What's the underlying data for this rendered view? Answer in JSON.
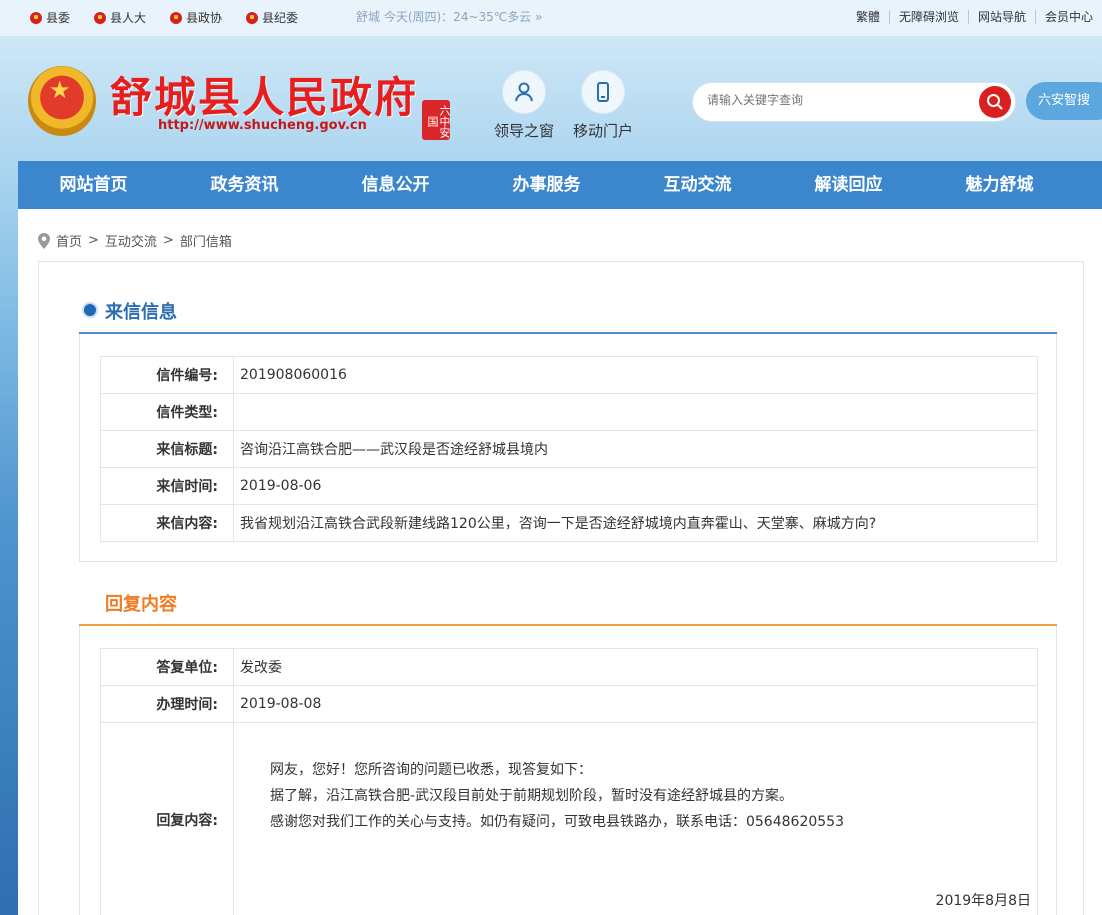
{
  "topbar": {
    "links": [
      "县委",
      "县人大",
      "县政协",
      "县纪委"
    ],
    "weather": "舒城   今天(周四)：24~35℃多云 »",
    "right": [
      "繁體",
      "无障碍浏览",
      "网站导航",
      "会员中心"
    ]
  },
  "header": {
    "title": "舒城县人民政府",
    "url": "http://www.shucheng.gov.cn",
    "seal_text": "六中安国",
    "quick": [
      {
        "label": "领导之窗",
        "icon": "person-icon"
      },
      {
        "label": "移动门户",
        "icon": "mobile-icon"
      }
    ],
    "search_placeholder": "请输入关键字查询",
    "la_search": "六安智搜"
  },
  "nav": [
    "网站首页",
    "政务资讯",
    "信息公开",
    "办事服务",
    "互动交流",
    "解读回应",
    "魅力舒城"
  ],
  "breadcrumb": {
    "home": "首页",
    "sep": ">",
    "level1": "互动交流",
    "level2": "部门信箱"
  },
  "letter": {
    "section_title": "来信信息",
    "rows": [
      {
        "label": "信件编号:",
        "value": "201908060016"
      },
      {
        "label": "信件类型:",
        "value": ""
      },
      {
        "label": "来信标题:",
        "value": "咨询沿江高铁合肥——武汉段是否途经舒城县境内"
      },
      {
        "label": "来信时间:",
        "value": "2019-08-06"
      },
      {
        "label": "来信内容:",
        "value": "我省规划沿江高铁合武段新建线路120公里，咨询一下是否途经舒城境内直奔霍山、天堂寨、麻城方向?"
      }
    ]
  },
  "reply": {
    "section_title": "回复内容",
    "unit_label": "答复单位:",
    "unit_value": "发改委",
    "time_label": "办理时间:",
    "time_value": "2019-08-08",
    "content_label": "回复内容:",
    "lines": [
      "网友，您好！您所咨询的问题已收悉，现答复如下：",
      "据了解，沿江高铁合肥-武汉段目前处于前期规划阶段，暂时没有途经舒城县的方案。",
      "感谢您对我们工作的关心与支持。如仍有疑问，可致电县铁路办，联系电话：05648620553"
    ],
    "date": "2019年8月8日"
  }
}
